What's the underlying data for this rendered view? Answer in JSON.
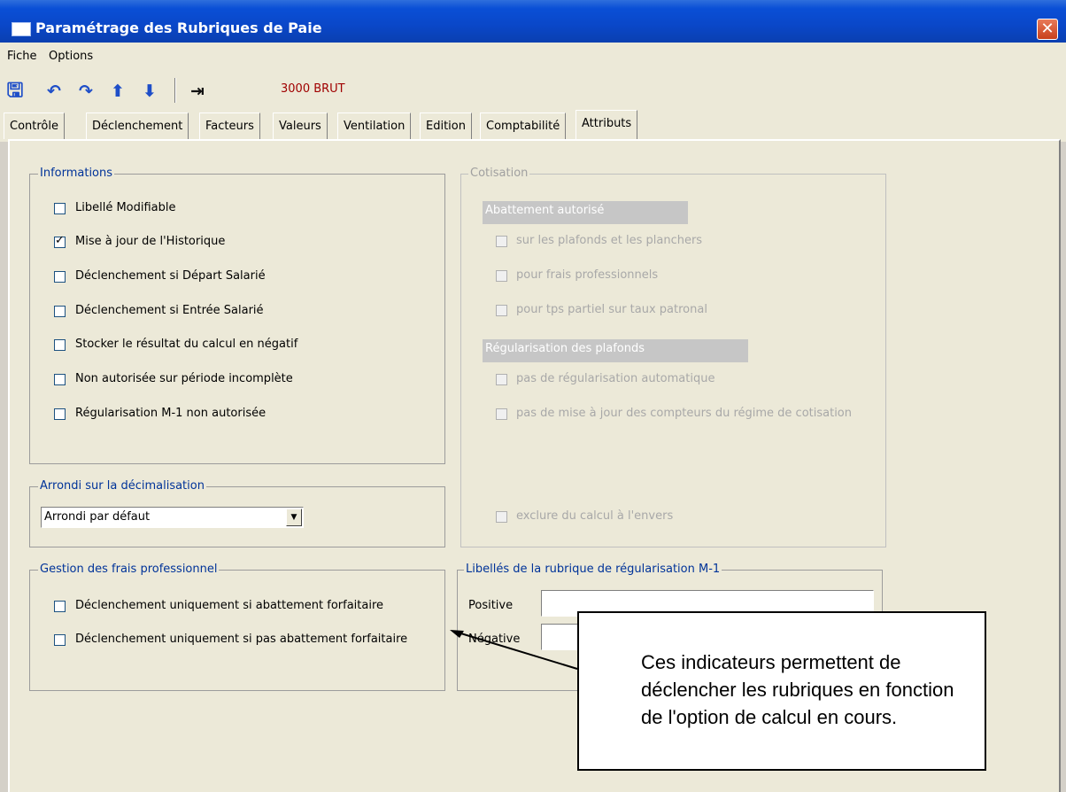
{
  "window": {
    "title": "Paramétrage des Rubriques de Paie"
  },
  "menu": [
    "Fiche",
    "Options"
  ],
  "toolbar": {
    "code": "3000   BRUT",
    "icons": [
      "save-icon",
      "undo-icon",
      "redo-icon",
      "arrow-up-icon",
      "arrow-down-icon",
      "exit-icon"
    ]
  },
  "tabs": [
    "Contrôle",
    "Déclenchement",
    "Facteurs",
    "Valeurs",
    "Ventilation",
    "Edition",
    "Comptabilité",
    "Attributs"
  ],
  "active_tab": "Attributs",
  "informations": {
    "label": "Informations",
    "items": [
      {
        "label": "Libellé Modifiable",
        "checked": false
      },
      {
        "label": "Mise à jour de l'Historique",
        "checked": true
      },
      {
        "label": "Déclenchement si Départ Salarié",
        "checked": false
      },
      {
        "label": "Déclenchement si Entrée Salarié",
        "checked": false
      },
      {
        "label": "Stocker le résultat du calcul en négatif",
        "checked": false
      },
      {
        "label": "Non autorisée sur période incomplète",
        "checked": false
      },
      {
        "label": "Régularisation M-1 non autorisée",
        "checked": false
      }
    ]
  },
  "cotisation": {
    "label": "Cotisation",
    "abattement_label": "Abattement autorisé",
    "abattement_items": [
      "sur les plafonds et les planchers",
      "pour frais professionnels",
      "pour tps partiel sur taux patronal"
    ],
    "regul_label": "Régularisation des plafonds",
    "regul_items": [
      "pas de régularisation automatique",
      "pas de mise à jour des compteurs du régime de cotisation"
    ],
    "exclure": "exclure du calcul à l'envers"
  },
  "arrondi": {
    "label": "Arrondi sur la décimalisation",
    "value": "Arrondi par défaut"
  },
  "frais": {
    "label": "Gestion des frais professionnel",
    "items": [
      "Déclenchement uniquement si abattement forfaitaire",
      "Déclenchement uniquement si  pas abattement forfaitaire"
    ]
  },
  "libelles": {
    "label": "Libellés de la rubrique de régularisation M-1",
    "positive": "Positive",
    "negative": "Négative"
  },
  "callout": {
    "text": "Ces indicateurs permettent de déclencher les rubriques en fonction de l'option de calcul en cours."
  }
}
